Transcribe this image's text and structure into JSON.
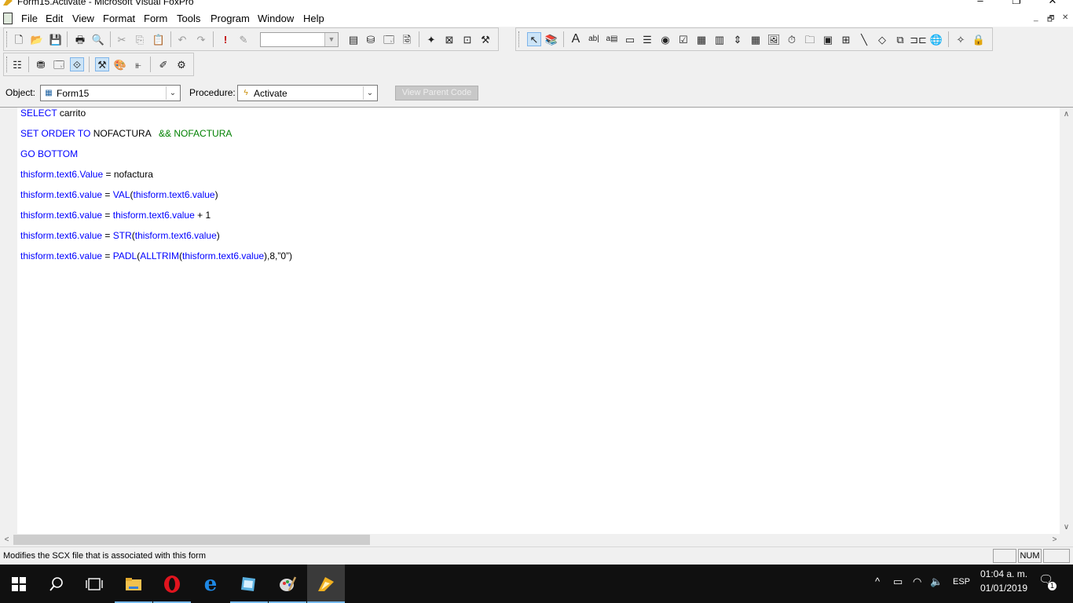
{
  "window": {
    "title": "Form15.Activate - Microsoft Visual FoxPro",
    "minimize": "–",
    "restore": "❐",
    "close": "✕"
  },
  "menu": [
    "File",
    "Edit",
    "View",
    "Format",
    "Form",
    "Tools",
    "Program",
    "Window",
    "Help"
  ],
  "mdi_controls": [
    "_",
    "🗗",
    "✕"
  ],
  "toolbar": {
    "combo_value": ""
  },
  "objbar": {
    "object_label": "Object:",
    "object_value": "Form15",
    "procedure_label": "Procedure:",
    "procedure_value": "Activate",
    "view_parent_label": "View Parent Code"
  },
  "code": [
    {
      "parts": [
        {
          "t": "SELECT ",
          "c": "kw"
        },
        {
          "t": "carrito",
          "c": "pl"
        }
      ]
    },
    {
      "parts": [
        {
          "t": "SET ORDER TO ",
          "c": "kw"
        },
        {
          "t": "NOFACTURA   ",
          "c": "pl"
        },
        {
          "t": "&& NOFACTURA",
          "c": "cm"
        }
      ]
    },
    {
      "parts": [
        {
          "t": "GO BOTTOM",
          "c": "kw"
        }
      ]
    },
    {
      "parts": [
        {
          "t": "thisform.text6.Value",
          "c": "kw"
        },
        {
          "t": " = nofactura",
          "c": "pl"
        }
      ]
    },
    {
      "parts": [
        {
          "t": "thisform.text6.value",
          "c": "kw"
        },
        {
          "t": " = ",
          "c": "pl"
        },
        {
          "t": "VAL",
          "c": "kw"
        },
        {
          "t": "(",
          "c": "pl"
        },
        {
          "t": "thisform.text6.value",
          "c": "kw"
        },
        {
          "t": ")",
          "c": "pl"
        }
      ]
    },
    {
      "parts": [
        {
          "t": "thisform.text6.value",
          "c": "kw"
        },
        {
          "t": " = ",
          "c": "pl"
        },
        {
          "t": "thisform.text6.value",
          "c": "kw"
        },
        {
          "t": " + 1",
          "c": "pl"
        }
      ]
    },
    {
      "parts": [
        {
          "t": "thisform.text6.value",
          "c": "kw"
        },
        {
          "t": " = ",
          "c": "pl"
        },
        {
          "t": "STR",
          "c": "kw"
        },
        {
          "t": "(",
          "c": "pl"
        },
        {
          "t": "thisform.text6.value",
          "c": "kw"
        },
        {
          "t": ")",
          "c": "pl"
        }
      ]
    },
    {
      "parts": [
        {
          "t": "thisform.text6.value",
          "c": "kw"
        },
        {
          "t": " = ",
          "c": "pl"
        },
        {
          "t": "PADL",
          "c": "kw"
        },
        {
          "t": "(",
          "c": "pl"
        },
        {
          "t": "ALLTRIM",
          "c": "kw"
        },
        {
          "t": "(",
          "c": "pl"
        },
        {
          "t": "thisform.text6.value",
          "c": "kw"
        },
        {
          "t": "),8,”0”)",
          "c": "pl"
        }
      ]
    }
  ],
  "status": {
    "message": "Modifies the SCX file that is associated with this form",
    "panel_num": "NUM"
  },
  "taskbar": {
    "lang": "ESP",
    "time": "01:04 a. m.",
    "date": "01/01/2019",
    "notif_count": "1"
  },
  "colors": {
    "keyword": "#0000ff",
    "comment": "#008000",
    "taskbar_bg": "#101010",
    "accent": "#76b9ed"
  }
}
